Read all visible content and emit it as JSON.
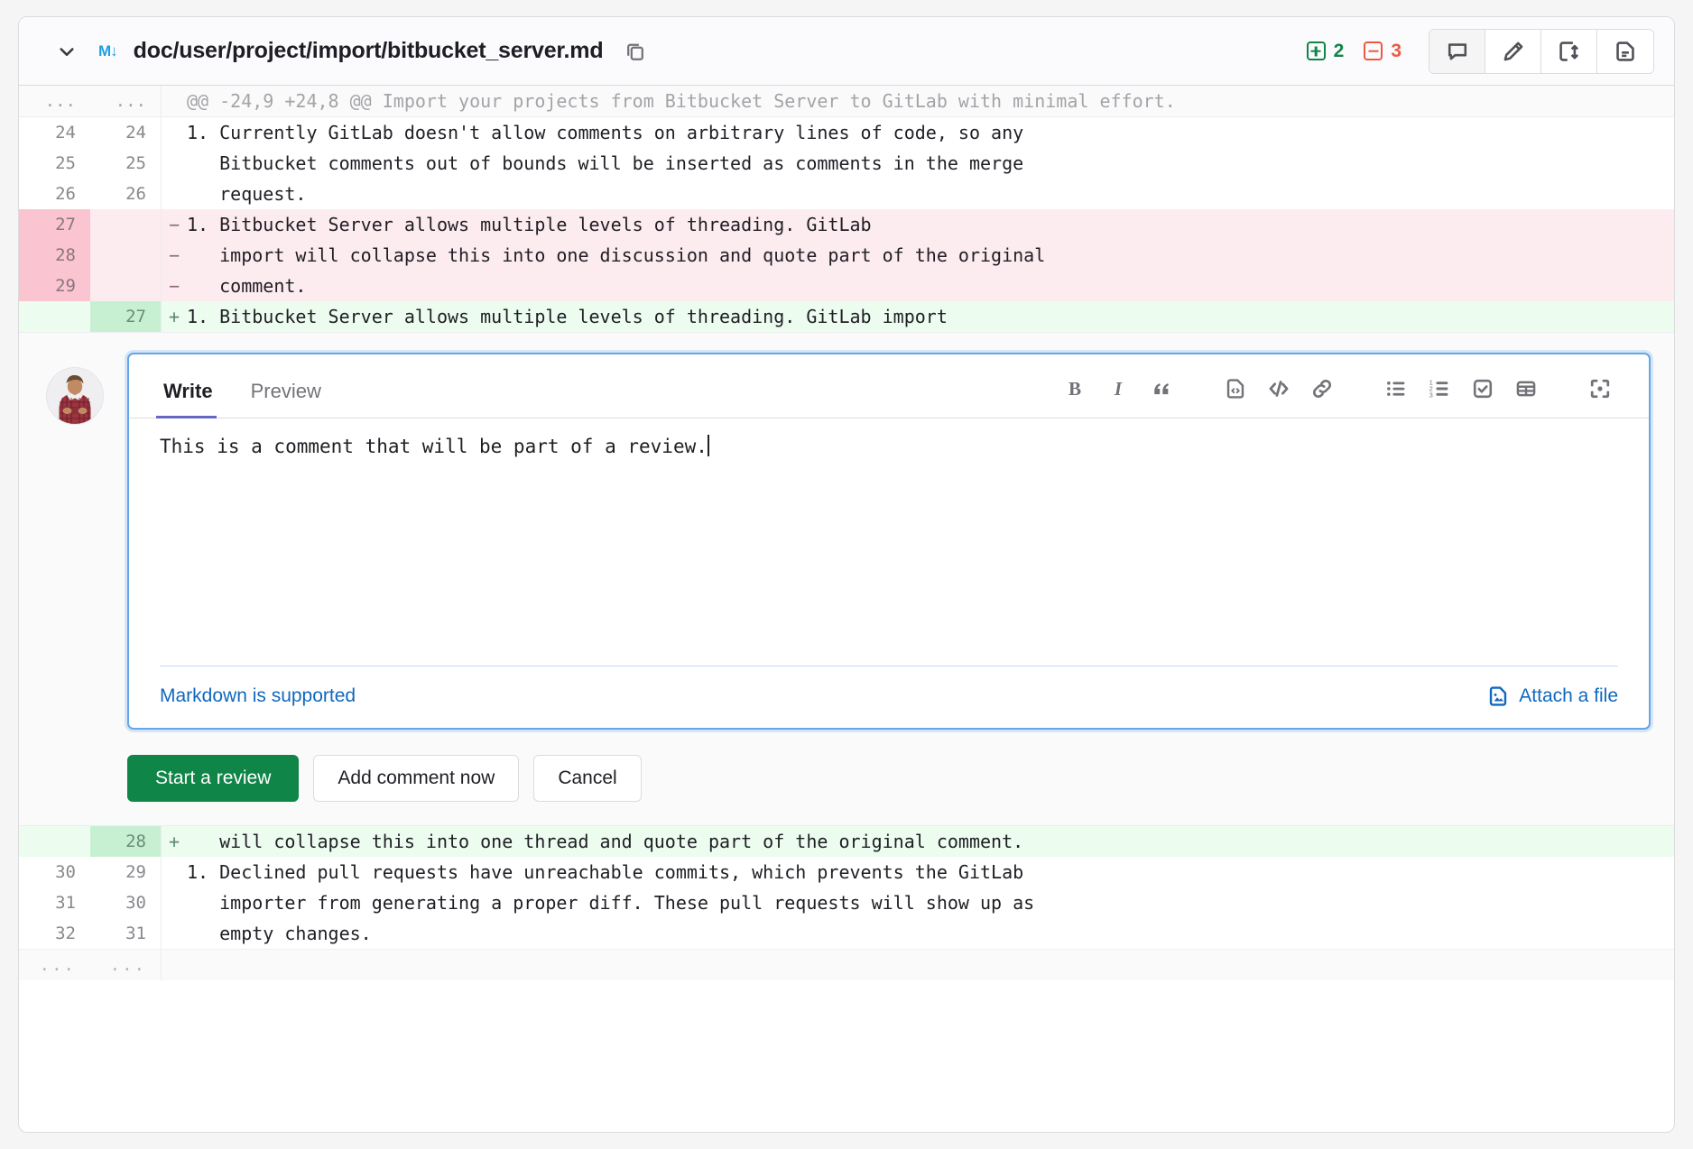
{
  "header": {
    "file_icon_label": "M↓",
    "file_path": "doc/user/project/import/bitbucket_server.md",
    "additions": "2",
    "deletions": "3",
    "actions": [
      {
        "name": "comment-button",
        "label": "Comment on this file"
      },
      {
        "name": "edit-button",
        "label": "Edit in single-file editor"
      },
      {
        "name": "compare-button",
        "label": "Toggle file changes"
      },
      {
        "name": "view-file-button",
        "label": "View file"
      }
    ]
  },
  "diff": {
    "hunk_header": "@@ -24,9 +24,8 @@ Import your projects from Bitbucket Server to GitLab with minimal effort.",
    "ellipsis": "...",
    "rows_top": [
      {
        "old": "24",
        "new": "24",
        "marker": "",
        "type": "ctx",
        "code": "1. Currently GitLab doesn't allow comments on arbitrary lines of code, so any"
      },
      {
        "old": "25",
        "new": "25",
        "marker": "",
        "type": "ctx",
        "code": "   Bitbucket comments out of bounds will be inserted as comments in the merge"
      },
      {
        "old": "26",
        "new": "26",
        "marker": "",
        "type": "ctx",
        "code": "   request."
      },
      {
        "old": "27",
        "new": "",
        "marker": "−",
        "type": "del",
        "code": "1. Bitbucket Server allows multiple levels of threading. GitLab"
      },
      {
        "old": "28",
        "new": "",
        "marker": "−",
        "type": "del",
        "code": "   import will collapse this into one discussion and quote part of the original"
      },
      {
        "old": "29",
        "new": "",
        "marker": "−",
        "type": "del",
        "code": "   comment."
      },
      {
        "old": "",
        "new": "27",
        "marker": "+",
        "type": "add",
        "code": "1. Bitbucket Server allows multiple levels of threading. GitLab import"
      }
    ],
    "rows_bottom": [
      {
        "old": "",
        "new": "28",
        "marker": "+",
        "type": "add",
        "code": "   will collapse this into one thread and quote part of the original comment."
      },
      {
        "old": "30",
        "new": "29",
        "marker": "",
        "type": "ctx",
        "code": "1. Declined pull requests have unreachable commits, which prevents the GitLab"
      },
      {
        "old": "31",
        "new": "30",
        "marker": "",
        "type": "ctx",
        "code": "   importer from generating a proper diff. These pull requests will show up as"
      },
      {
        "old": "32",
        "new": "31",
        "marker": "",
        "type": "ctx",
        "code": "   empty changes."
      }
    ]
  },
  "comment_form": {
    "tabs": [
      {
        "label": "Write",
        "active": true
      },
      {
        "label": "Preview",
        "active": false
      }
    ],
    "toolbar": [
      {
        "name": "bold-icon",
        "label": "Add bold text"
      },
      {
        "name": "italic-icon",
        "label": "Add italic text"
      },
      {
        "name": "quote-icon",
        "label": "Insert a quote"
      },
      {
        "name": "code-block-icon",
        "label": "Insert a code block"
      },
      {
        "name": "inline-code-icon",
        "label": "Insert code"
      },
      {
        "name": "link-icon",
        "label": "Add a link"
      },
      {
        "name": "bullet-list-icon",
        "label": "Add a bullet list"
      },
      {
        "name": "numbered-list-icon",
        "label": "Add a numbered list"
      },
      {
        "name": "task-list-icon",
        "label": "Add a checklist"
      },
      {
        "name": "table-icon",
        "label": "Add a table"
      },
      {
        "name": "fullscreen-icon",
        "label": "Go full screen"
      }
    ],
    "body_text": "This is a comment that will be part of a review.",
    "markdown_note": "Markdown is supported",
    "attach_label": "Attach a file",
    "buttons": [
      {
        "label": "Start a review",
        "style": "primary"
      },
      {
        "label": "Add comment now",
        "style": "default"
      },
      {
        "label": "Cancel",
        "style": "default"
      }
    ]
  },
  "colors": {
    "accent_green": "#108548",
    "accent_red": "#ec5941",
    "link_blue": "#1068bf",
    "focus_blue": "#63a6e9",
    "tab_underline": "#6666c4",
    "md_icon_blue": "#1f9ede"
  }
}
